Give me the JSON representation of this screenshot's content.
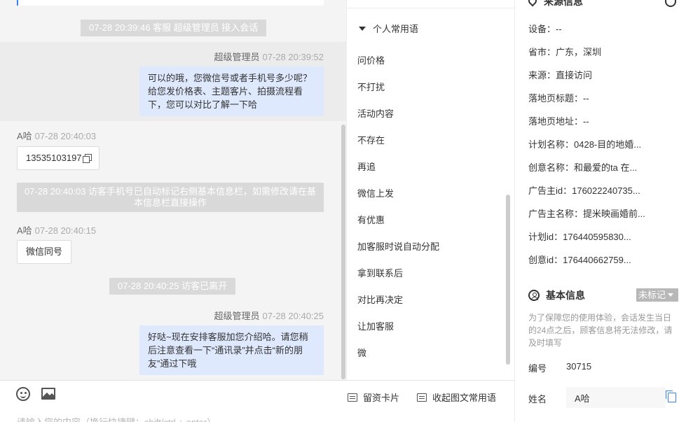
{
  "chat": {
    "sys1": "07-28 20:39:46 客服 超级管理员 接入会话",
    "msg1": {
      "sender": "超级管理员",
      "time": "07-28 20:39:52",
      "text": "可以的哦，您微信号或者手机号多少呢？给您发价格表、主题客片、拍摄流程看下，您可以对比了解一下哈"
    },
    "msg2": {
      "sender": "A哈",
      "time": "07-28 20:40:03",
      "text": "13535103197"
    },
    "sys2": "07-28 20:40:03 访客手机号已自动标记右侧基本信息栏，如需修改请在基本信息栏直接操作",
    "msg3": {
      "sender": "A哈",
      "time": "07-28 20:40:15",
      "text": "微信同号"
    },
    "sys3": "07-28 20:40:25 访客已离开",
    "msg4": {
      "sender": "超级管理员",
      "time": "07-28 20:40:25",
      "text": "好哒~现在安排客服加您介绍哈。请您稍后注意查看一下“通讯录”并点击“新的朋友”通过下哦"
    }
  },
  "input": {
    "card_label": "留资卡片",
    "collapse_label": "收起图文常用语",
    "placeholder": "请输入您的内容（换行快捷键：shift/ctrl + enter）"
  },
  "phrases": {
    "header": "个人常用语",
    "items": [
      "问价格",
      "不打扰",
      "活动内容",
      "不存在",
      "再追",
      "微信上发",
      "有优惠",
      "加客服时说自动分配",
      "拿到联系后",
      "对比再决定",
      "让加客服",
      "微"
    ]
  },
  "info": {
    "source_title": "来源信息",
    "source_rows": [
      "设备：--",
      "省市：广东，深圳",
      "来源：直接访问",
      "落地页标题：--",
      "落地页地址：--",
      "计划名称：0428-目的地婚...",
      "创意名称：和最爱的ta 在...",
      "广告主id：176022240735...",
      "广告主名称：提米映画婚前...",
      "计划id：176440595830...",
      "创意id：176440662759..."
    ],
    "basic_title": "基本信息",
    "badge": "未标记",
    "note": "为了保障您的使用体验，会话发生当日的24点之后，顾客信息将无法修改，请及时填写",
    "id_label": "编号",
    "id_value": "30715",
    "name_label": "姓名",
    "name_value": "A哈"
  }
}
